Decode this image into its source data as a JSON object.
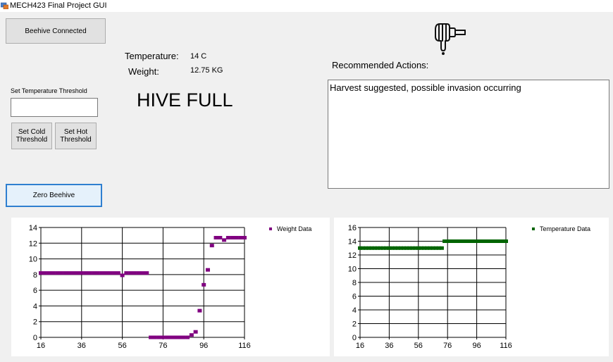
{
  "window": {
    "title": "MECH423 Final Project GUI"
  },
  "buttons": {
    "connect": "Beehive Connected",
    "set_cold": "Set Cold\nThreshold",
    "set_hot": "Set Hot\nThreshold",
    "zero": "Zero Beehive"
  },
  "threshold": {
    "label": "Set Temperature Threshold",
    "value": ""
  },
  "readings": {
    "temperature_label": "Temperature:",
    "temperature_value": "14 C",
    "weight_label": "Weight:",
    "weight_value": "12.75 KG"
  },
  "status": "HIVE FULL",
  "logo": {
    "icon": "honey-dipper-icon"
  },
  "recommended": {
    "label": "Recommended Actions:",
    "text": "Harvest suggested, possible invasion occurring"
  },
  "colors": {
    "weight_series": "#800080",
    "temperature_series": "#006400",
    "focus_border": "#2f7fd0"
  },
  "chart_data": [
    {
      "type": "scatter",
      "legend": [
        "Weight Data"
      ],
      "xticks": [
        "16",
        "36",
        "56",
        "76",
        "96",
        "116"
      ],
      "yticks": [
        "0",
        "2",
        "4",
        "6",
        "8",
        "10",
        "12",
        "14"
      ],
      "xlim": [
        16,
        116
      ],
      "ylim": [
        0,
        14
      ],
      "grid": true,
      "legend_position": "top-right",
      "series": [
        {
          "name": "Weight Data",
          "x": [
            16,
            18,
            20,
            22,
            24,
            26,
            28,
            30,
            32,
            34,
            36,
            38,
            40,
            42,
            44,
            46,
            48,
            50,
            52,
            54,
            56,
            58,
            60,
            62,
            64,
            66,
            68,
            70,
            72,
            74,
            76,
            78,
            80,
            82,
            84,
            86,
            88,
            90,
            92,
            94,
            96,
            98,
            100,
            102,
            104,
            106,
            108,
            110,
            112,
            114,
            116
          ],
          "y": [
            8.2,
            8.2,
            8.2,
            8.2,
            8.2,
            8.2,
            8.2,
            8.2,
            8.2,
            8.2,
            8.2,
            8.2,
            8.2,
            8.2,
            8.2,
            8.2,
            8.2,
            8.2,
            8.2,
            8.2,
            7.9,
            8.2,
            8.2,
            8.2,
            8.2,
            8.2,
            8.2,
            0,
            0,
            0,
            0,
            0,
            0,
            0,
            0,
            0,
            0,
            0.3,
            0.7,
            3.4,
            6.7,
            8.6,
            11.7,
            12.7,
            12.7,
            12.4,
            12.7,
            12.7,
            12.7,
            12.7,
            12.7
          ]
        }
      ]
    },
    {
      "type": "scatter",
      "legend": [
        "Temperature Data"
      ],
      "xticks": [
        "16",
        "36",
        "56",
        "76",
        "96",
        "116"
      ],
      "yticks": [
        "0",
        "2",
        "4",
        "6",
        "8",
        "10",
        "12",
        "14",
        "16"
      ],
      "xlim": [
        16,
        116
      ],
      "ylim": [
        0,
        16
      ],
      "grid": true,
      "legend_position": "top-right",
      "series": [
        {
          "name": "Temperature Data",
          "x": [
            16,
            18,
            20,
            22,
            24,
            26,
            28,
            30,
            32,
            34,
            36,
            38,
            40,
            42,
            44,
            46,
            48,
            50,
            52,
            54,
            56,
            58,
            60,
            62,
            64,
            66,
            68,
            70,
            72,
            74,
            76,
            78,
            80,
            82,
            84,
            86,
            88,
            90,
            92,
            94,
            96,
            98,
            100,
            102,
            104,
            106,
            108,
            110,
            112,
            114,
            116
          ],
          "y": [
            13,
            13,
            13,
            13,
            13,
            13,
            13,
            13,
            13,
            13,
            13,
            13,
            13,
            13,
            13,
            13,
            13,
            13,
            13,
            13,
            13,
            13,
            13,
            13,
            13,
            13,
            13,
            13,
            13,
            14,
            14,
            14,
            14,
            14,
            14,
            14,
            14,
            14,
            14,
            14,
            14,
            14,
            14,
            14,
            14,
            14,
            14,
            14,
            14,
            14,
            14
          ]
        }
      ]
    }
  ]
}
